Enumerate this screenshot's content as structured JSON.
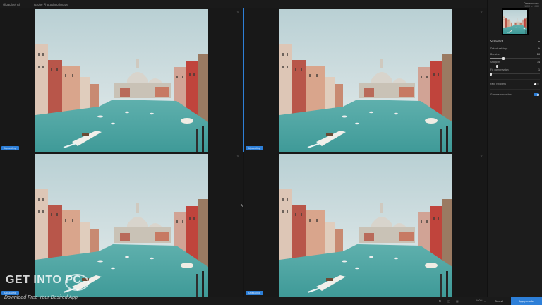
{
  "topbar": {
    "app_name": "Gigapixel AI",
    "breadcrumb": "Adobe Photoshop Image"
  },
  "panes": [
    {
      "badge": "Upscaling",
      "close": "×"
    },
    {
      "badge": "Upscaling",
      "close": "×"
    },
    {
      "badge": "Upscaling",
      "close": "×"
    },
    {
      "badge": "Upscaling",
      "close": "×"
    }
  ],
  "side": {
    "dimensions_label": "Dimensions",
    "dimensions_value": "1920 × 1080",
    "model": "Standard",
    "model_chevron": "▾",
    "detect_settings_label": "Detect settings",
    "detect_settings_icon": "⚙",
    "denoise_label": "Denoise",
    "denoise_value": "26",
    "denoise_level": 0.26,
    "sharpen_label": "Sharpen",
    "sharpen_value": "14",
    "sharpen_level": 0.14,
    "fix_compression_label": "Fix compression",
    "fix_compression_value": "1",
    "fix_compression_level": 0.01,
    "face_recovery_label": "Face recovery",
    "face_recovery_on": false,
    "gamma_label": "Gamma correction",
    "gamma_on": true
  },
  "bottombar": {
    "zoom": "100%",
    "cancel": "Cancel",
    "apply": "Apply model"
  },
  "watermark": {
    "title": "GET INTO PC",
    "subtitle": "Download Free Your Desired App"
  },
  "cursor": "↖",
  "colors": {
    "accent": "#2d7fd8",
    "sky": "#d6e3e6",
    "water": "#3f9a98"
  }
}
